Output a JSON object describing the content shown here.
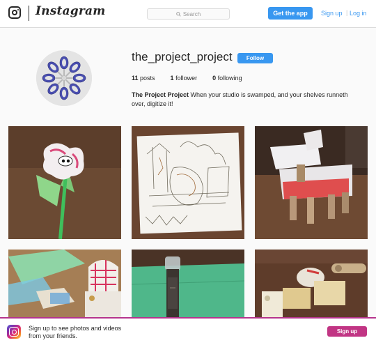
{
  "header": {
    "wordmark": "Instagram",
    "search_placeholder": "Search",
    "get_app_label": "Get the app",
    "signup_label": "Sign up",
    "separator": "|",
    "login_label": "Log in"
  },
  "profile": {
    "username": "the_project_project",
    "follow_label": "Follow",
    "stats": {
      "posts_count": "11",
      "posts_label": "posts",
      "followers_count": "1",
      "followers_label": "follower",
      "following_count": "0",
      "following_label": "following"
    },
    "bio_name": "The Project Project",
    "bio_text": "When your studio is swamped, and your shelves runneth over, digitize it!"
  },
  "posts": [
    {
      "subject": "paper-flower-on-straw"
    },
    {
      "subject": "pencil-drawing"
    },
    {
      "subject": "tube-robot-sculpture"
    },
    {
      "subject": "paper-collage-with-box"
    },
    {
      "subject": "bottle-on-green-paper"
    },
    {
      "subject": "cardboard-tubes-on-table"
    }
  ],
  "banner": {
    "text": "Sign up to see photos and videos from your friends.",
    "signup_label": "Sign up"
  },
  "colors": {
    "accent": "#3897f0",
    "banner_button": "#c13584",
    "banner_border": "#b5348d"
  }
}
